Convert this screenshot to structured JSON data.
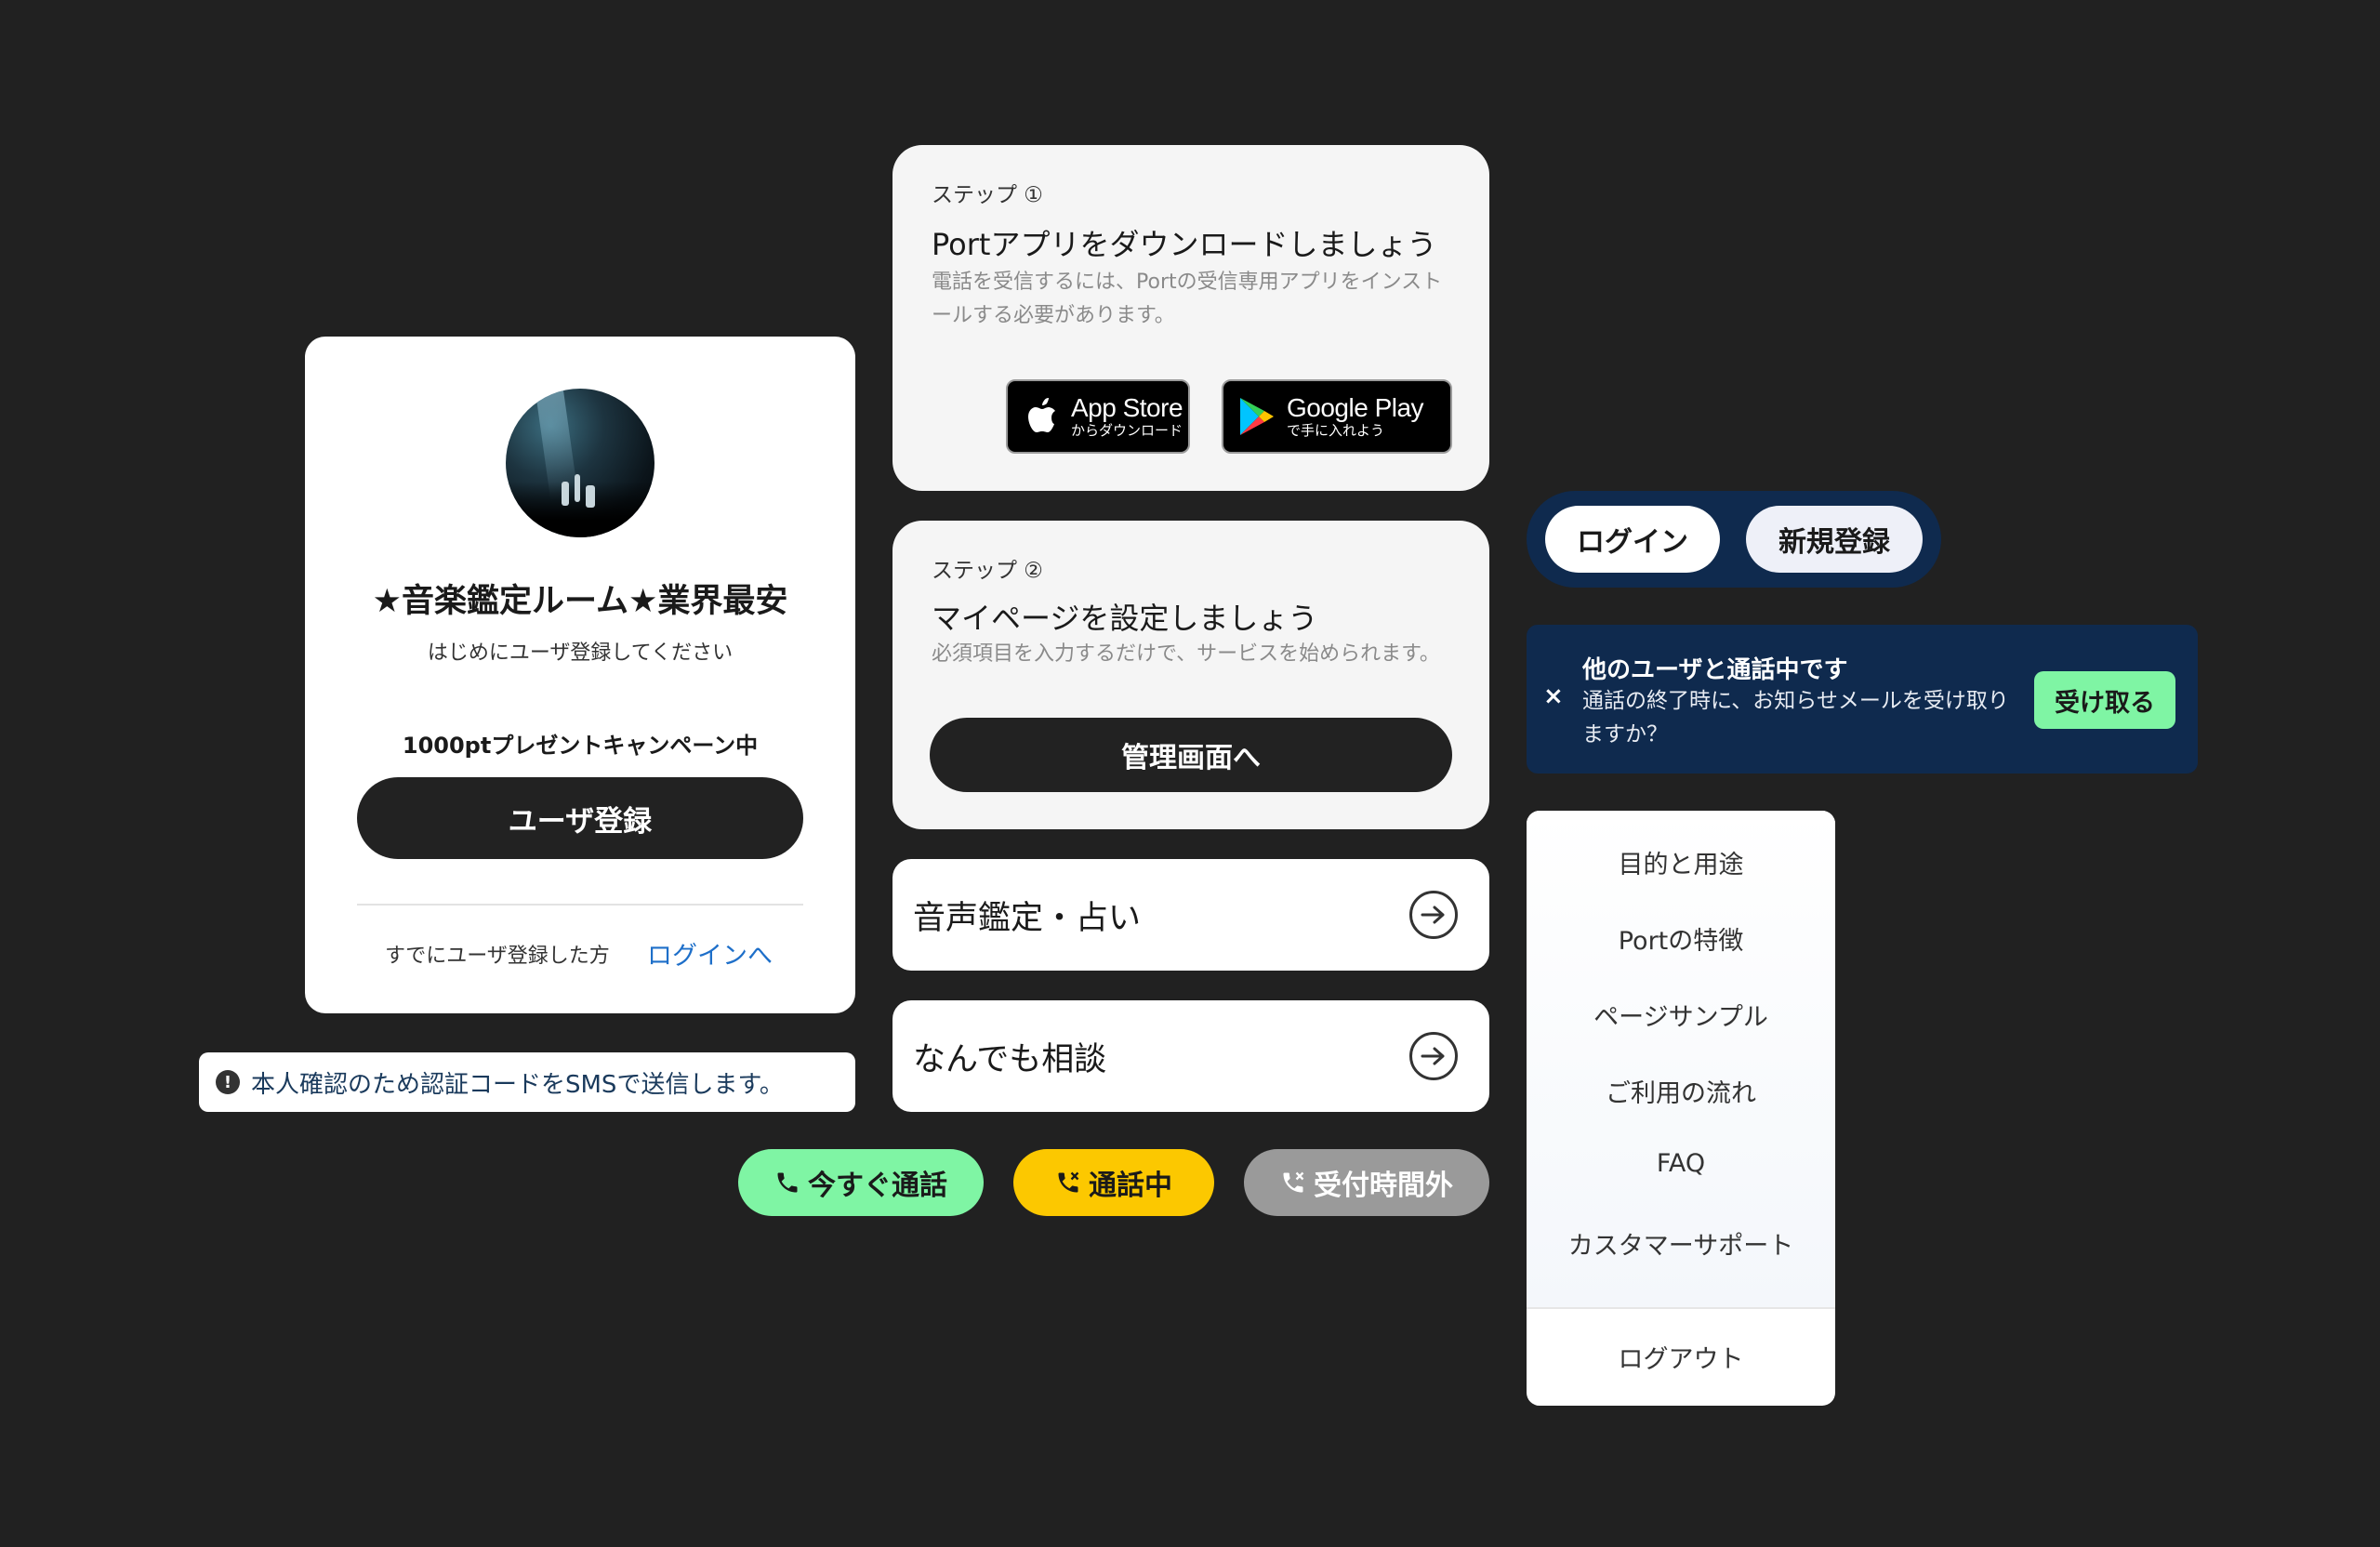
{
  "profile_card": {
    "title": "★音楽鑑定ルーム★業界最安",
    "subtitle": "はじめにユーザ登録してください",
    "campaign": "1000ptプレゼントキャンペーン中",
    "register_label": "ユーザ登録",
    "already_text": "すでにユーザ登録した方",
    "login_link": "ログインへ"
  },
  "sms_notice": {
    "icon": "!",
    "text": "本人確認のため認証コードをSMSで送信します。"
  },
  "step1": {
    "label": "ステップ ①",
    "title": "Portアプリをダウンロードしましょう",
    "description": "電話を受信するには、Portの受信専用アプリをインストールする必要があります。",
    "app_store": {
      "main": "App Store",
      "sub": "からダウンロード"
    },
    "google_play": {
      "main": "Google Play",
      "sub": "で手に入れよう"
    }
  },
  "step2": {
    "label": "ステップ ②",
    "title": "マイページを設定しましょう",
    "description": "必須項目を入力するだけで、サービスを始められます。",
    "button_label": "管理画面へ"
  },
  "categories": [
    {
      "label": "音声鑑定・占い",
      "icon": "arrow-right-circle-icon"
    },
    {
      "label": "なんでも相談",
      "icon": "arrow-right-circle-icon"
    }
  ],
  "status_pills": {
    "now": {
      "label": "今すぐ通話",
      "icon": "phone-icon",
      "color": "#7ff5a4"
    },
    "busy": {
      "label": "通話中",
      "icon": "phone-busy-icon",
      "color": "#fcc800"
    },
    "off": {
      "label": "受付時間外",
      "icon": "phone-missed-icon",
      "color": "#9a9a9a"
    }
  },
  "auth": {
    "login_label": "ログイン",
    "signup_label": "新規登録"
  },
  "call_notice": {
    "close": "×",
    "title": "他のユーザと通話中です",
    "body": "通話の終了時に、お知らせメールを受け取りますか？",
    "button_label": "受け取る"
  },
  "menu": {
    "items": [
      "目的と用途",
      "Portの特徴",
      "ページサンプル",
      "ご利用の流れ",
      "FAQ",
      "カスタマーサポート"
    ],
    "logout": "ログアウト"
  },
  "colors": {
    "background": "#212121",
    "navy": "#0f2a4e",
    "green": "#7ff5a4",
    "yellow": "#fcc800",
    "link_blue": "#1e6fc9"
  }
}
